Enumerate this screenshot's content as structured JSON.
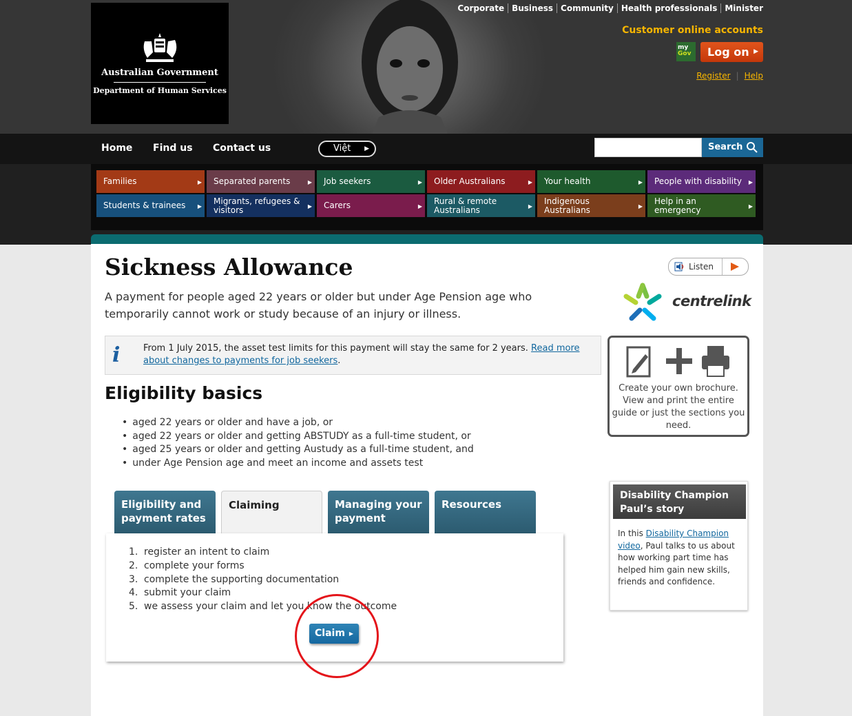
{
  "header": {
    "agency": "Australian Government",
    "department": "Department of Human Services",
    "top_links": [
      "Corporate",
      "Business",
      "Community",
      "Health professionals",
      "Minister"
    ],
    "customer_accounts_title": "Customer online accounts",
    "mygov_badge": [
      "my",
      "Gov"
    ],
    "logon_label": "Log on",
    "register_label": "Register",
    "help_label": "Help"
  },
  "nav": {
    "items": [
      "Home",
      "Find us",
      "Contact us"
    ],
    "language": "Việt",
    "search_label": "Search",
    "search_value": ""
  },
  "categories": [
    {
      "label": "Families",
      "color": "#a33a16"
    },
    {
      "label": "Separated parents",
      "color": "#6a3c49"
    },
    {
      "label": "Job seekers",
      "color": "#1b5b40"
    },
    {
      "label": "Older Australians",
      "color": "#8d1c1f"
    },
    {
      "label": "Your health",
      "color": "#1e5a2d"
    },
    {
      "label": "People with disability",
      "color": "#5c2b7a"
    },
    {
      "label": "Students & trainees",
      "color": "#17507c"
    },
    {
      "label": "Migrants, refugees & visitors",
      "color": "#14305f"
    },
    {
      "label": "Carers",
      "color": "#7a1c4c"
    },
    {
      "label": "Rural & remote Australians",
      "color": "#1c5a64"
    },
    {
      "label": "Indigenous Australians",
      "color": "#7b3e1c"
    },
    {
      "label": "Help in an emergency",
      "color": "#2f5b22"
    }
  ],
  "page": {
    "title": "Sickness Allowance",
    "intro": "A payment for people aged 22 years or older but under Age Pension age who temporarily cannot work or study because of an injury or illness.",
    "listen_label": "Listen",
    "brand": "centrelink"
  },
  "notice": {
    "text": "From 1 July 2015, the asset test limits for this payment will stay the same for 2 years. ",
    "link": "Read more about changes to payments for job seekers",
    "end": "."
  },
  "brochure": {
    "text": "Create your own brochure. View and print the entire guide or just the sections you need."
  },
  "eligibility": {
    "title": "Eligibility basics",
    "items": [
      "aged 22 years or older and have a job, or",
      "aged 22 years or older and getting ABSTUDY as a full-time student, or",
      "aged 25 years or older and getting Austudy as a full-time student, and",
      "under Age Pension age and meet an income and assets test"
    ]
  },
  "tabs": [
    {
      "label": "Eligibility and payment rates",
      "active": false
    },
    {
      "label": "Claiming",
      "active": true
    },
    {
      "label": "Managing your payment",
      "active": false
    },
    {
      "label": "Resources",
      "active": false
    }
  ],
  "claiming": {
    "steps": [
      "register an intent to claim",
      "complete your forms",
      "complete the supporting documentation",
      "submit your claim",
      "we assess your claim and let you know the outcome"
    ],
    "claim_label": "Claim"
  },
  "story": {
    "title": "Disability Champion Paul’s story",
    "text_before": "In this ",
    "link": "Disability Champion video",
    "text_after": ", Paul talks to us about how working part time has helped him gain new skills, friends and confidence."
  }
}
